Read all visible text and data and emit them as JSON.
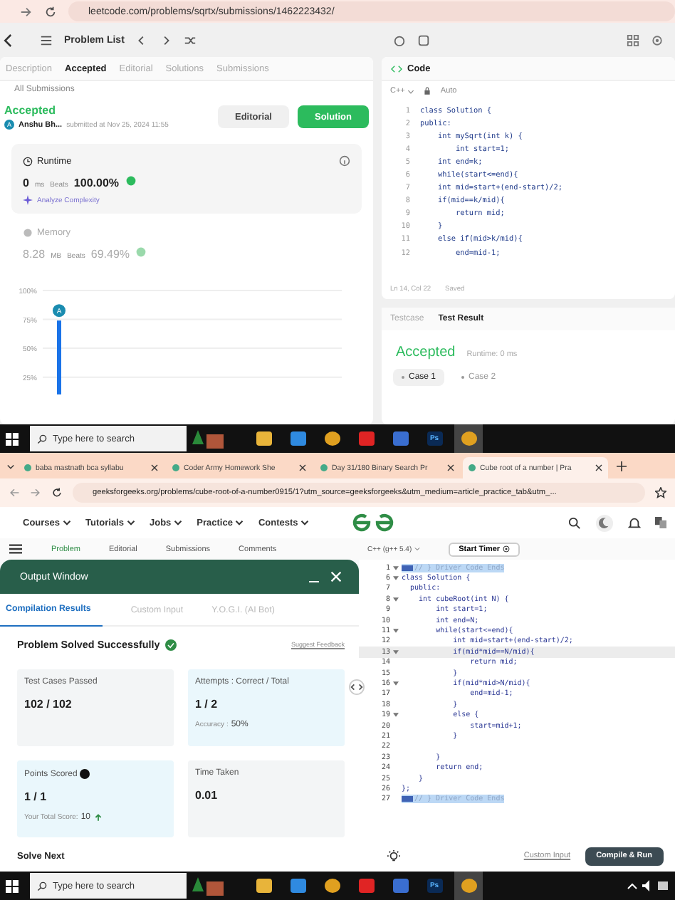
{
  "leetcode": {
    "url": "leetcode.com/problems/sqrtx/submissions/1462223432/",
    "toolbar_title": "Problem List",
    "tabs": [
      {
        "label": "Description",
        "selected": false
      },
      {
        "label": "Accepted",
        "selected": true
      },
      {
        "label": "Editorial",
        "selected": false
      },
      {
        "label": "Solutions",
        "selected": false
      },
      {
        "label": "Submissions",
        "selected": false
      }
    ],
    "breadcrumb": "All Submissions",
    "status": "Accepted",
    "avatar": "A",
    "author": "Anshu Bh...",
    "submitted": "submitted at Nov 25, 2024 11:55",
    "buttons": [
      {
        "label": "Editorial",
        "kind": "secondary"
      },
      {
        "label": "Solution",
        "kind": "primary"
      }
    ],
    "runtime": {
      "title": "Runtime",
      "value": "0",
      "unit": "ms",
      "beats_label": "Beats",
      "beats": "100.00%",
      "link": "Analyze Complexity"
    },
    "memory": {
      "title": "Memory",
      "value": "8.28",
      "unit": "MB",
      "beats_label": "Beats",
      "beats": "69.49%"
    },
    "chart_data": {
      "type": "bar",
      "grid": true,
      "categories": [
        "A"
      ],
      "values": [
        74
      ],
      "ylim": [
        10,
        100
      ],
      "yticks": [
        {
          "value": 25,
          "label": "25%"
        },
        {
          "value": 50,
          "label": "50%"
        },
        {
          "value": 75,
          "label": "75%"
        },
        {
          "value": 100,
          "label": "100%"
        }
      ]
    },
    "code_title": "Code",
    "language": "C++",
    "mode": "Auto",
    "code": [
      {
        "n": "1",
        "text": "class Solution {"
      },
      {
        "n": "2",
        "text": "public:"
      },
      {
        "n": "3",
        "text": "    int mySqrt(int k) {"
      },
      {
        "n": "4",
        "text": "        int start=1;"
      },
      {
        "n": "5",
        "text": "    int end=k;"
      },
      {
        "n": "6",
        "text": "    while(start<=end){"
      },
      {
        "n": "7",
        "text": "    int mid=start+(end-start)/2;"
      },
      {
        "n": "8",
        "text": "    if(mid==k/mid){"
      },
      {
        "n": "9",
        "text": "        return mid;"
      },
      {
        "n": "10",
        "text": "    }"
      },
      {
        "n": "11",
        "text": "    else if(mid>k/mid){"
      },
      {
        "n": "12",
        "text": "        end=mid-1;"
      }
    ],
    "position": "Ln 14, Col 22",
    "saved": "Saved",
    "result_tabs": [
      {
        "label": "Testcase",
        "selected": false
      },
      {
        "label": "Test Result",
        "selected": true
      }
    ],
    "result": "Accepted",
    "result_runtime": "Runtime: 0 ms",
    "cases": [
      {
        "label": "Case 1",
        "selected": true
      },
      {
        "label": "Case 2",
        "selected": false
      }
    ]
  },
  "taskbars": [
    {
      "placeholder": "Type here to search",
      "tray": false,
      "apps": [
        {
          "kind": "folder",
          "selected": false
        },
        {
          "kind": "vscode",
          "selected": false
        },
        {
          "kind": "chrome",
          "selected": false
        },
        {
          "kind": "youtube",
          "selected": false
        },
        {
          "kind": "doc",
          "selected": false
        },
        {
          "kind": "ps",
          "label": "Ps",
          "selected": false
        },
        {
          "kind": "chrome",
          "selected": true
        }
      ]
    },
    {
      "placeholder": "Type here to search",
      "tray": true,
      "apps": [
        {
          "kind": "folder",
          "selected": false
        },
        {
          "kind": "vscode",
          "selected": false
        },
        {
          "kind": "chrome",
          "selected": false
        },
        {
          "kind": "youtube",
          "selected": false
        },
        {
          "kind": "doc",
          "selected": false
        },
        {
          "kind": "ps",
          "label": "Ps",
          "selected": false
        },
        {
          "kind": "chrome",
          "selected": true
        }
      ]
    }
  ],
  "gfg": {
    "browser_tabs": [
      {
        "title": "baba mastnath bca syllabu",
        "selected": false
      },
      {
        "title": "Coder Army Homework She",
        "selected": false
      },
      {
        "title": "Day 31/180 Binary Search Pr",
        "selected": false
      },
      {
        "title": "Cube root of a number | Pra",
        "selected": true
      }
    ],
    "url": "geeksforgeeks.org/problems/cube-root-of-a-number0915/1?utm_source=geeksforgeeks&utm_medium=article_practice_tab&utm_...",
    "nav": [
      "Courses",
      "Tutorials",
      "Jobs",
      "Practice",
      "Contests"
    ],
    "problem_tabs": [
      {
        "label": "Problem",
        "selected": true
      },
      {
        "label": "Editorial",
        "selected": false
      },
      {
        "label": "Submissions",
        "selected": false
      },
      {
        "label": "Comments",
        "selected": false
      }
    ],
    "language": "C++ (g++ 5.4)",
    "timer": "Start Timer",
    "output": {
      "title": "Output Window",
      "tabs": [
        {
          "label": "Compilation Results",
          "selected": true
        },
        {
          "label": "Custom Input",
          "selected": false
        },
        {
          "label": "Y.O.G.I. (AI Bot)",
          "selected": false
        }
      ],
      "headline": "Problem Solved Successfully",
      "feedback": "Suggest Feedback",
      "cards": [
        {
          "label": "Test Cases Passed",
          "value": "102 / 102",
          "kind": "plain"
        },
        {
          "label": "Attempts : Correct / Total",
          "value": "1 / 2",
          "note_label": "Accuracy :",
          "note": "50%",
          "kind": "highlight"
        },
        {
          "label": "Points Scored",
          "value": "1 / 1",
          "note_label": "Your Total Score:",
          "note": "10",
          "kind": "highlight"
        },
        {
          "label": "Time Taken",
          "value": "0.01",
          "kind": "plain"
        }
      ],
      "solve_next": "Solve Next"
    },
    "code": [
      {
        "n": "1",
        "text": "// } Driver Code Ends",
        "kind": "fold",
        "foldable": true,
        "current": false
      },
      {
        "n": "6",
        "text": "class Solution {",
        "kind": "code",
        "foldable": true,
        "current": false
      },
      {
        "n": "7",
        "text": "  public:",
        "kind": "code",
        "foldable": false,
        "current": false
      },
      {
        "n": "8",
        "text": "    int cubeRoot(int N) {",
        "kind": "code",
        "foldable": true,
        "current": false
      },
      {
        "n": "9",
        "text": "        int start=1;",
        "kind": "code",
        "foldable": false,
        "current": false
      },
      {
        "n": "10",
        "text": "        int end=N;",
        "kind": "code",
        "foldable": false,
        "current": false
      },
      {
        "n": "11",
        "text": "        while(start<=end){",
        "kind": "code",
        "foldable": true,
        "current": false
      },
      {
        "n": "12",
        "text": "            int mid=start+(end-start)/2;",
        "kind": "code",
        "foldable": false,
        "current": false
      },
      {
        "n": "13",
        "text": "            if(mid*mid==N/mid){",
        "kind": "code",
        "foldable": true,
        "current": true
      },
      {
        "n": "14",
        "text": "                return mid;",
        "kind": "code",
        "foldable": false,
        "current": false
      },
      {
        "n": "15",
        "text": "            }",
        "kind": "code",
        "foldable": false,
        "current": false
      },
      {
        "n": "16",
        "text": "            if(mid*mid>N/mid){",
        "kind": "code",
        "foldable": true,
        "current": false
      },
      {
        "n": "17",
        "text": "                end=mid-1;",
        "kind": "code",
        "foldable": false,
        "current": false
      },
      {
        "n": "18",
        "text": "            }",
        "kind": "code",
        "foldable": false,
        "current": false
      },
      {
        "n": "19",
        "text": "            else {",
        "kind": "code",
        "foldable": true,
        "current": false
      },
      {
        "n": "20",
        "text": "                start=mid+1;",
        "kind": "code",
        "foldable": false,
        "current": false
      },
      {
        "n": "21",
        "text": "            }",
        "kind": "code",
        "foldable": false,
        "current": false
      },
      {
        "n": "22",
        "kind": "code",
        "foldable": false,
        "current": false
      },
      {
        "n": "23",
        "text": "        }",
        "kind": "code",
        "foldable": false,
        "current": false
      },
      {
        "n": "24",
        "text": "        return end;",
        "kind": "code",
        "foldable": false,
        "current": false
      },
      {
        "n": "25",
        "text": "    }",
        "kind": "code",
        "foldable": false,
        "current": false
      },
      {
        "n": "26",
        "text": "};",
        "kind": "code",
        "foldable": false,
        "current": false
      },
      {
        "n": "27",
        "text": "// } Driver Code Ends",
        "kind": "fold",
        "foldable": false,
        "current": false
      }
    ],
    "footer_link": "Custom Input",
    "run_button": "Compile & Run"
  }
}
